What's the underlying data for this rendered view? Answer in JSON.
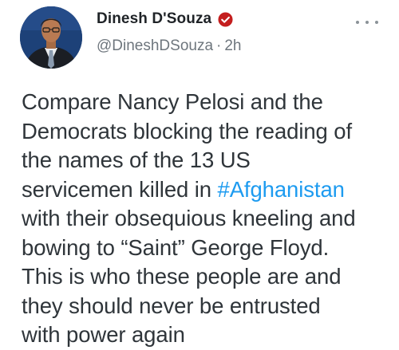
{
  "author": {
    "display_name": "Dinesh D'Souza",
    "handle": "@DineshDSouza",
    "separator": "·",
    "time": "2h",
    "verified": true,
    "avatar_icon": "profile-photo"
  },
  "more_icon": "more-horizontal-icon",
  "colors": {
    "verified_badge": "#c41e1e",
    "hashtag": "#1d9bf0",
    "muted": "#6e767d"
  },
  "tweet": {
    "lines": [
      {
        "pre": "Compare Nancy Pelosi and the",
        "hashtag": "",
        "post": ""
      },
      {
        "pre": "Democrats blocking the reading of",
        "hashtag": "",
        "post": ""
      },
      {
        "pre": "the names of the 13 US",
        "hashtag": "",
        "post": ""
      },
      {
        "pre": "servicemen killed in ",
        "hashtag": "#Afghanistan",
        "post": ""
      },
      {
        "pre": "with their obsequious kneeling and",
        "hashtag": "",
        "post": ""
      },
      {
        "pre": "bowing to “Saint” George Floyd.",
        "hashtag": "",
        "post": ""
      },
      {
        "pre": "This is who these people are and",
        "hashtag": "",
        "post": ""
      },
      {
        "pre": "they should never be entrusted",
        "hashtag": "",
        "post": ""
      },
      {
        "pre": "with power again",
        "hashtag": "",
        "post": ""
      }
    ]
  }
}
